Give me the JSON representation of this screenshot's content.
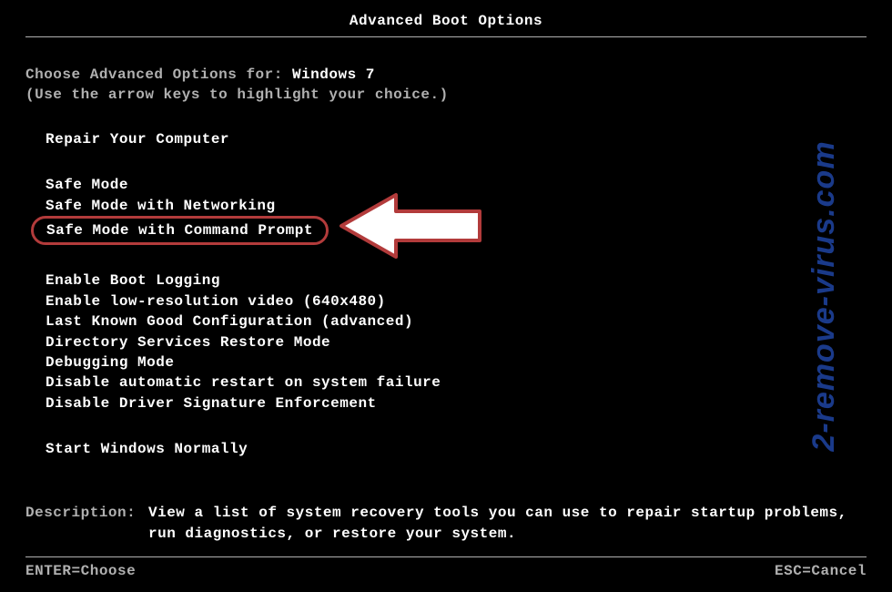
{
  "title": "Advanced Boot Options",
  "intro": {
    "label": "Choose Advanced Options for:",
    "os_name": "Windows 7",
    "hint": "(Use the arrow keys to highlight your choice.)"
  },
  "options": {
    "repair": "Repair Your Computer",
    "safe_mode": "Safe Mode",
    "safe_mode_networking": "Safe Mode with Networking",
    "safe_mode_cmd": "Safe Mode with Command Prompt",
    "boot_logging": "Enable Boot Logging",
    "low_res_video": "Enable low-resolution video (640x480)",
    "last_known_good": "Last Known Good Configuration (advanced)",
    "ds_restore": "Directory Services Restore Mode",
    "debugging": "Debugging Mode",
    "disable_auto_restart": "Disable automatic restart on system failure",
    "disable_driver_sig": "Disable Driver Signature Enforcement",
    "start_normally": "Start Windows Normally"
  },
  "description": {
    "label": "Description:",
    "text": "View a list of system recovery tools you can use to repair startup problems, run diagnostics, or restore your system."
  },
  "footer": {
    "enter": "ENTER=Choose",
    "esc": "ESC=Cancel"
  },
  "watermark": "2-remove-virus.com"
}
